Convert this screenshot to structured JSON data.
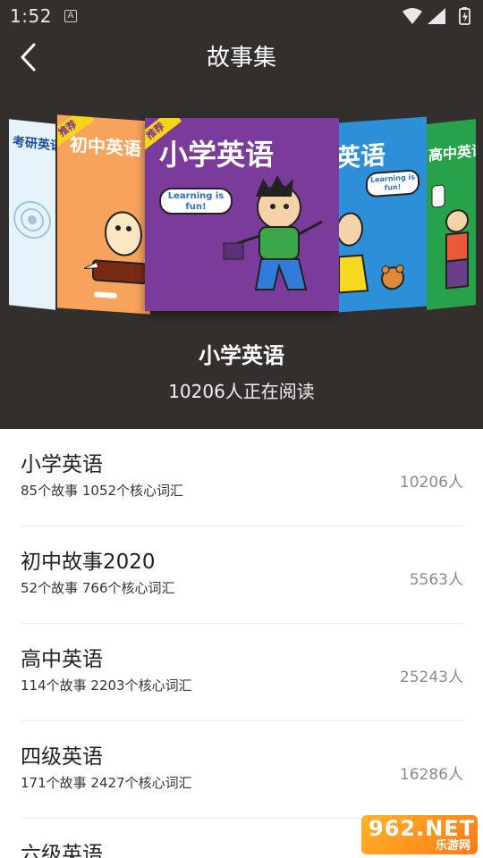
{
  "status_bar": {
    "time": "1:52",
    "notification_glyph": "A",
    "icons": [
      "wifi-icon",
      "signal-icon",
      "battery-icon"
    ]
  },
  "header": {
    "title": "故事集",
    "background": "#332f2c"
  },
  "carousel": {
    "books": [
      {
        "title": "考研英语",
        "color": "#e6f3fb",
        "tag": ""
      },
      {
        "title": "初中英语",
        "color": "#f7a35c",
        "tag": "推荐"
      },
      {
        "title": "小学英语",
        "color": "#7a3b9a",
        "tag": "推荐",
        "speech": "Learning is fun!"
      },
      {
        "title": "英语",
        "color": "#2c8fd8",
        "tag": "",
        "speech": "Learning is fun!"
      },
      {
        "title": "高中英语",
        "color": "#28a24a",
        "tag": ""
      }
    ]
  },
  "featured": {
    "title": "小学英语",
    "readers": "10206人正在阅读"
  },
  "list": [
    {
      "name": "小学英语",
      "meta": "85个故事 1052个核心词汇",
      "count": "10206人"
    },
    {
      "name": "初中故事2020",
      "meta": "52个故事 766个核心词汇",
      "count": "5563人"
    },
    {
      "name": "高中英语",
      "meta": "114个故事 2203个核心词汇",
      "count": "25243人"
    },
    {
      "name": "四级英语",
      "meta": "171个故事 2427个核心词汇",
      "count": "16286人"
    },
    {
      "name": "六级英语",
      "meta": "",
      "count": ""
    }
  ],
  "watermark": {
    "top": "962.NET",
    "bottom": "乐游网"
  }
}
